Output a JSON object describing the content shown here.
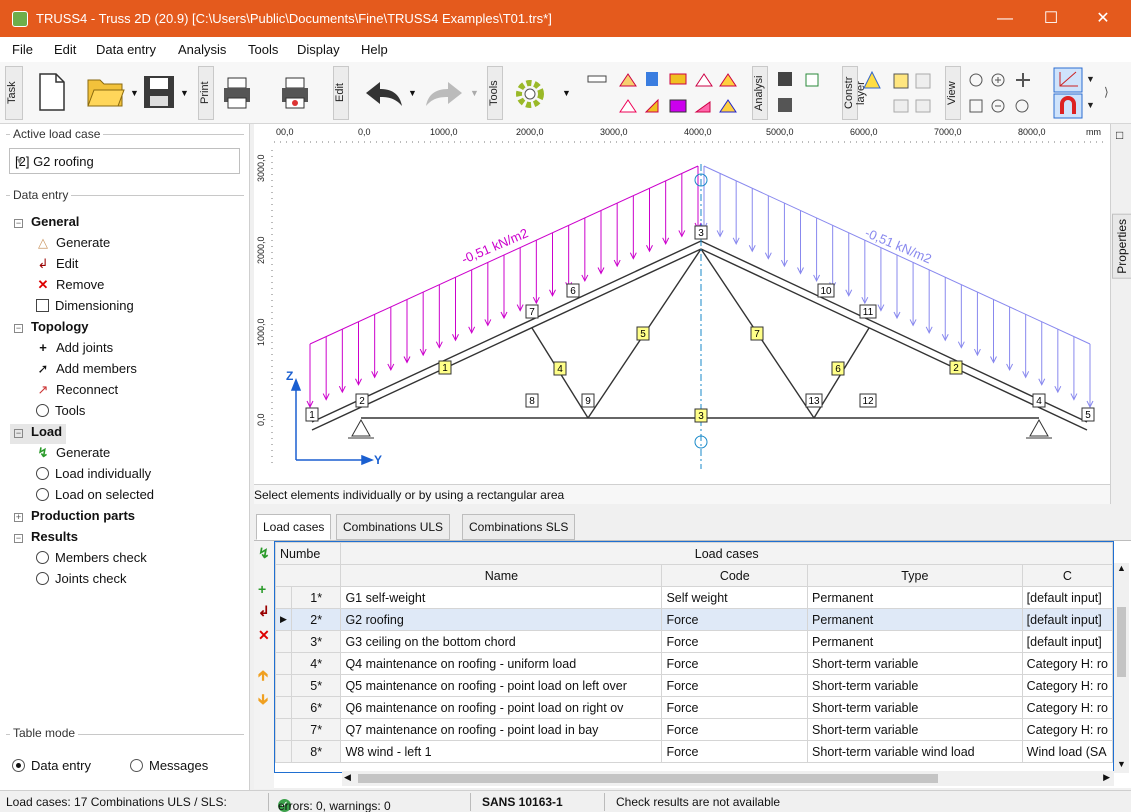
{
  "window": {
    "title": "TRUSS4 - Truss 2D  (20.9)  [C:\\Users\\Public\\Documents\\Fine\\TRUSS4 Examples\\T01.trs*]"
  },
  "menu": [
    "File",
    "Edit",
    "Data entry",
    "Analysis",
    "Tools",
    "Display",
    "Help"
  ],
  "toolbar": {
    "task_label": "Task",
    "print_label": "Print",
    "edit_label": "Edit",
    "tools_label": "Tools",
    "analysis_label": "Analysi",
    "construct_label": "Constr layer",
    "view_label": "View"
  },
  "left": {
    "active_load_case_header": "Active load case",
    "active_load_case_value": "[2] G2 roofing",
    "data_entry_header": "Data entry",
    "tree": {
      "general": "General",
      "generate": "Generate",
      "edit": "Edit",
      "remove": "Remove",
      "dimensioning": "Dimensioning",
      "topology": "Topology",
      "add_joints": "Add joints",
      "add_members": "Add members",
      "reconnect": "Reconnect",
      "tools": "Tools",
      "load": "Load",
      "load_generate": "Generate",
      "load_individually": "Load individually",
      "load_on_selected": "Load on selected",
      "production_parts": "Production parts",
      "results": "Results",
      "members_check": "Members check",
      "joints_check": "Joints check"
    },
    "table_mode_header": "Table mode",
    "mode_data_entry": "Data entry",
    "mode_messages": "Messages"
  },
  "ruler": {
    "ticks": [
      "00,0",
      "0,0",
      "1000,0",
      "2000,0",
      "3000,0",
      "4000,0",
      "5000,0",
      "6000,0",
      "7000,0",
      "8000,0"
    ],
    "unit": "mm",
    "vticks": [
      "3000,0",
      "2000,0",
      "1000,0",
      "0,0"
    ]
  },
  "drawing": {
    "left_load_label": "-0,51 kN/m2",
    "right_load_label": "-0,51 kN/m2",
    "axis_z": "Z",
    "axis_y": "Y",
    "member_labels": [
      "1",
      "2",
      "3",
      "4",
      "5",
      "6",
      "7"
    ],
    "joint_labels": [
      "1",
      "2",
      "3",
      "4",
      "5",
      "6",
      "7",
      "8",
      "9",
      "10",
      "11",
      "12",
      "13",
      "3"
    ]
  },
  "hint": "Select elements individually or by  using a rectangular area",
  "tabs": [
    "Load cases",
    "Combinations ULS",
    "Combinations SLS"
  ],
  "table": {
    "number_header": "Numbe",
    "group_header": "Load cases",
    "columns": [
      "Name",
      "Code",
      "Type",
      "C"
    ],
    "rows": [
      {
        "num": "1*",
        "name": "G1 self-weight",
        "code": "Self weight",
        "type": "Permanent",
        "c": "[default input]"
      },
      {
        "num": "2*",
        "name": "G2 roofing",
        "code": "Force",
        "type": "Permanent",
        "c": "[default input]"
      },
      {
        "num": "3*",
        "name": "G3 ceiling on the bottom chord",
        "code": "Force",
        "type": "Permanent",
        "c": "[default input]"
      },
      {
        "num": "4*",
        "name": "Q4 maintenance on roofing - uniform load",
        "code": "Force",
        "type": "Short-term variable",
        "c": "Category H: ro"
      },
      {
        "num": "5*",
        "name": "Q5 maintenance on roofing - point load on left over",
        "code": "Force",
        "type": "Short-term variable",
        "c": "Category H: ro"
      },
      {
        "num": "6*",
        "name": "Q6 maintenance on roofing - point load on right ov",
        "code": "Force",
        "type": "Short-term variable",
        "c": "Category H: ro"
      },
      {
        "num": "7*",
        "name": "Q7 maintenance on roofing - point load in bay",
        "code": "Force",
        "type": "Short-term variable",
        "c": "Category H: ro"
      },
      {
        "num": "8*",
        "name": "W8 wind - left 1",
        "code": "Force",
        "type": "Short-term variable wind load",
        "c": "Wind load (SA"
      }
    ]
  },
  "status": {
    "load_cases": "Load cases: 17  Combinations ULS / SLS:",
    "errors": "errors: 0, warnings: 0",
    "standard": "SANS 10163-1",
    "check": "Check results are not available"
  },
  "colors": {
    "title_bar": "#e45a1d",
    "load_left": "#cc00cc",
    "load_right": "#8888ee",
    "selection": "#dfe9f7"
  }
}
